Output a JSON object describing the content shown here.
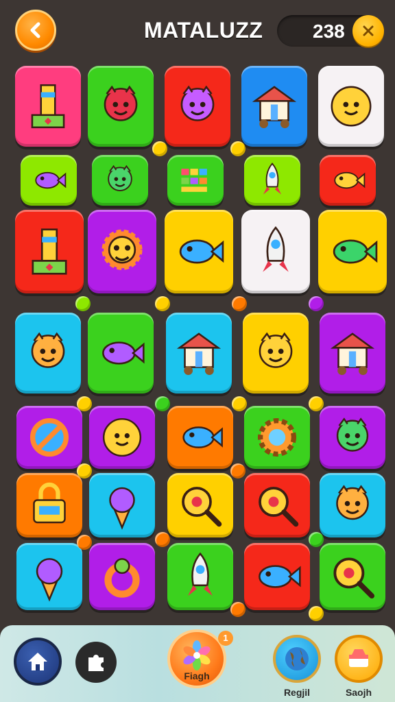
{
  "header": {
    "title": "MATALUZZ",
    "score": "238",
    "back_icon": "chevron-left-icon",
    "close_icon": "close-icon"
  },
  "colors": {
    "background": "#3d3633",
    "pink": "#ff3d7f",
    "green": "#3bd11e",
    "red": "#f5281a",
    "blue": "#1f8cf2",
    "white": "#f6f2f4",
    "yellow": "#ffd000",
    "purple": "#b11ee8",
    "orange": "#ff7a00",
    "cyan": "#1cc4ee",
    "lime": "#8ee800"
  },
  "board": {
    "tiles": [
      {
        "color": "pink",
        "icon": "lighthouse-icon"
      },
      {
        "color": "green",
        "icon": "devil-critter-icon"
      },
      {
        "color": "red",
        "icon": "purple-critter-icon"
      },
      {
        "color": "blue",
        "icon": "house-cart-icon"
      },
      {
        "color": "white",
        "icon": "smiley-face-icon"
      },
      {
        "color": "lime",
        "icon": "purple-fish-icon"
      },
      {
        "color": "green",
        "icon": "green-turtle-icon"
      },
      {
        "color": "green",
        "icon": "color-blocks-icon"
      },
      {
        "color": "lime",
        "icon": "rocket-icon"
      },
      {
        "color": "red",
        "icon": "yellow-fish-icon"
      },
      {
        "color": "red",
        "icon": "tower-icon"
      },
      {
        "color": "purple",
        "icon": "sunflower-icon"
      },
      {
        "color": "yellow",
        "icon": "blue-fish-icon"
      },
      {
        "color": "white",
        "icon": "rocket-ship-icon"
      },
      {
        "color": "yellow",
        "icon": "green-fish-icon"
      },
      {
        "color": "cyan",
        "icon": "pirate-kid-icon"
      },
      {
        "color": "green",
        "icon": "purple-fish-icon"
      },
      {
        "color": "cyan",
        "icon": "house-icon"
      },
      {
        "color": "yellow",
        "icon": "yellow-creature-icon"
      },
      {
        "color": "purple",
        "icon": "temple-icon"
      },
      {
        "color": "purple",
        "icon": "no-sign-icon"
      },
      {
        "color": "purple",
        "icon": "smiley-face-icon"
      },
      {
        "color": "orange",
        "icon": "blue-fish-icon"
      },
      {
        "color": "green",
        "icon": "gear-icon"
      },
      {
        "color": "purple",
        "icon": "green-creature-icon"
      },
      {
        "color": "orange",
        "icon": "lock-icon"
      },
      {
        "color": "cyan",
        "icon": "ice-cream-icon"
      },
      {
        "color": "yellow",
        "icon": "magnifier-icon"
      },
      {
        "color": "red",
        "icon": "magnifier-icon"
      },
      {
        "color": "cyan",
        "icon": "pirate-kid-icon"
      },
      {
        "color": "cyan",
        "icon": "ice-cream-critter-icon"
      },
      {
        "color": "purple",
        "icon": "ring-toy-icon"
      },
      {
        "color": "green",
        "icon": "bottle-icon"
      },
      {
        "color": "red",
        "icon": "blue-fish-icon"
      },
      {
        "color": "green",
        "icon": "magnifier-icon"
      }
    ]
  },
  "bottom_nav": {
    "home_icon": "home-icon",
    "puzzle_icon": "puzzle-piece-icon",
    "center_icon": "flower-icon",
    "center_label": "Fiagh",
    "center_badge": "1",
    "globe_icon": "globe-icon",
    "globe_label": "Regjil",
    "shop_icon": "shop-icon",
    "shop_label": "Saojh"
  }
}
